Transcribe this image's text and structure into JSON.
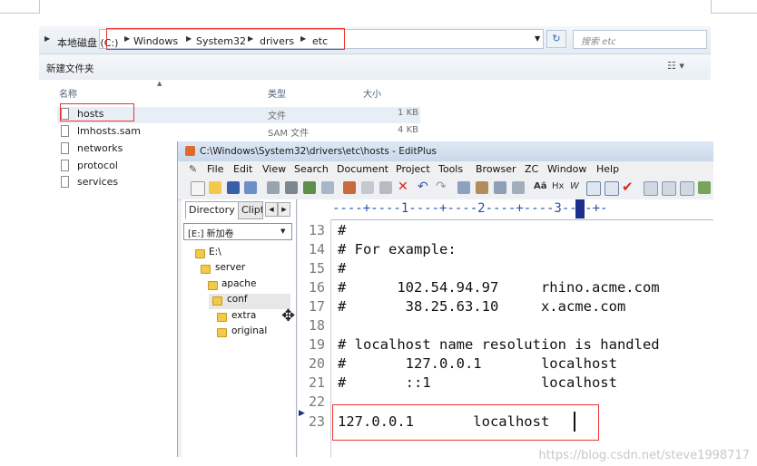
{
  "explorer": {
    "breadcrumbs": [
      "本地磁盘 (C:)",
      "Windows",
      "System32",
      "drivers",
      "etc"
    ],
    "search_placeholder": "搜索 etc",
    "toolbar_new_folder": "新建文件夹",
    "columns": {
      "name": "名称",
      "type": "类型",
      "size": "大小"
    },
    "files": [
      {
        "name": "hosts",
        "type": "文件",
        "size": "1 KB"
      },
      {
        "name": "lmhosts.sam",
        "type": "SAM 文件",
        "size": "4 KB"
      },
      {
        "name": "networks",
        "type": "",
        "size": ""
      },
      {
        "name": "protocol",
        "type": "",
        "size": ""
      },
      {
        "name": "services",
        "type": "",
        "size": ""
      }
    ]
  },
  "editplus": {
    "title": "C:\\Windows\\System32\\drivers\\etc\\hosts - EditPlus",
    "menu": [
      "File",
      "Edit",
      "View",
      "Search",
      "Document",
      "Project",
      "Tools",
      "Browser",
      "ZC",
      "Window",
      "Help"
    ],
    "dir_tabs": [
      "Directory",
      "Clipt"
    ],
    "drive": "[E:] 新加卷",
    "tree": [
      "E:\\",
      "server",
      "apache",
      "conf",
      "extra",
      "original"
    ],
    "ruler": "----+----1----+----2----+----3----+-",
    "lines": [
      {
        "num": "13",
        "text": "#"
      },
      {
        "num": "14",
        "text": "# For example:"
      },
      {
        "num": "15",
        "text": "#"
      },
      {
        "num": "16",
        "text": "#      102.54.94.97     rhino.acme.com"
      },
      {
        "num": "17",
        "text": "#       38.25.63.10     x.acme.com"
      },
      {
        "num": "18",
        "text": ""
      },
      {
        "num": "19",
        "text": "# localhost name resolution is handled"
      },
      {
        "num": "20",
        "text": "#       127.0.0.1       localhost"
      },
      {
        "num": "21",
        "text": "#       ::1             localhost"
      },
      {
        "num": "22",
        "text": ""
      },
      {
        "num": "23",
        "text": "127.0.0.1       localhost"
      }
    ]
  },
  "watermark": "https://blog.csdn.net/steve1998717",
  "colors": {
    "highlight": "#ee3333",
    "folder": "#f2c94c",
    "title_bar": "#c9d8ea"
  }
}
